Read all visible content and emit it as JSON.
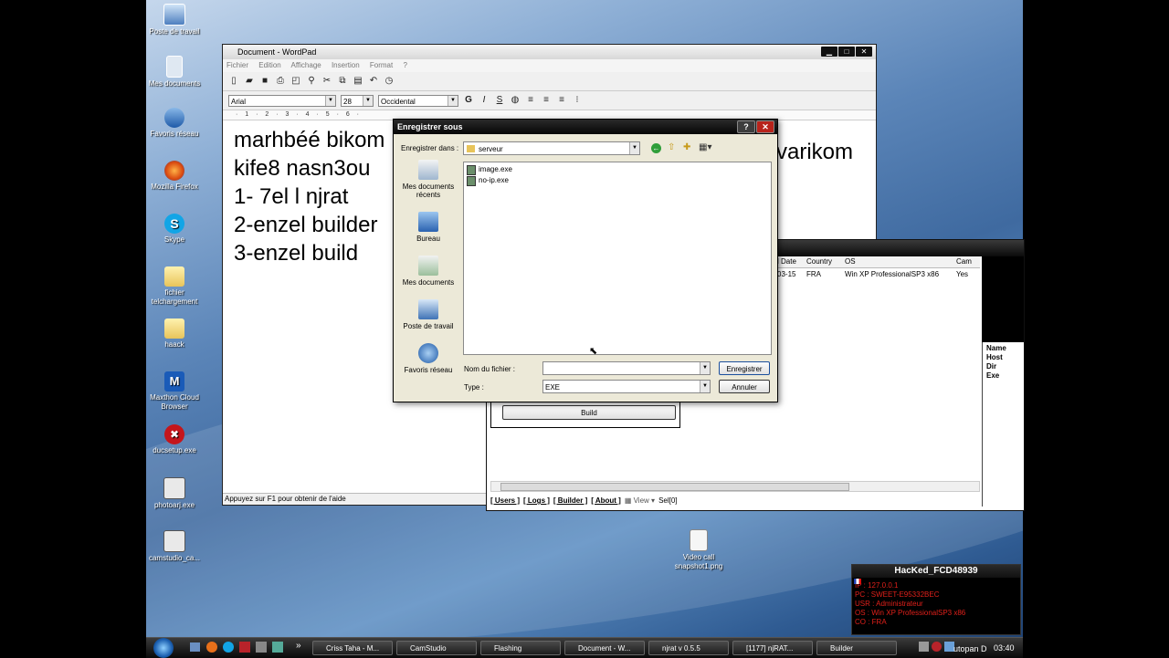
{
  "desktop_icons": [
    {
      "label": "Poste de travail"
    },
    {
      "label": "Mes documents"
    },
    {
      "label": "Favoris réseau"
    },
    {
      "label": "Mozilla Firefox"
    },
    {
      "label": "Skype"
    },
    {
      "label": "fichier telchargement"
    },
    {
      "label": "haack"
    },
    {
      "label": "Maxthon Cloud Browser"
    },
    {
      "label": "ducsetup.exe"
    },
    {
      "label": "photoarj.exe"
    },
    {
      "label": "camstudio_ca..."
    }
  ],
  "wordpad": {
    "title": "Document - WordPad",
    "menu": [
      "Fichier",
      "Edition",
      "Affichage",
      "Insertion",
      "Format",
      "?"
    ],
    "font": "Arial",
    "size": "28",
    "script": "Occidental",
    "ruler": "· 1 · 2 · 3 · 4 · 5 · 6 ·",
    "lines": [
      "marhbéé bikom",
      "kife8 nasn3ou",
      "1- 7el l njrat",
      "2-enzel builder",
      "3-enzel build"
    ],
    "right_text": "varikom",
    "status": "Appuyez sur F1 pour obtenir de l'aide"
  },
  "dialog": {
    "title": "Enregistrer sous",
    "save_in_label": "Enregistrer dans :",
    "save_in_value": "serveur",
    "places": [
      "Mes documents récents",
      "Bureau",
      "Mes documents",
      "Poste de travail",
      "Favoris réseau"
    ],
    "files": [
      "image.exe",
      "no-ip.exe"
    ],
    "filename_label": "Nom du fichier :",
    "filename_value": "",
    "type_label": "Type :",
    "type_value": "EXE",
    "save_button": "Enregistrer",
    "cancel_button": "Annuler",
    "help_glyph": "?",
    "close_glyph": "✕"
  },
  "njrat": {
    "columns": [
      "l Date",
      "Country",
      "OS",
      "Cam"
    ],
    "row": [
      "03-15",
      "FRA",
      "Win XP ProfessionalSP3 x86",
      "Yes"
    ],
    "side_fields": [
      "Name",
      "Host",
      "Dir",
      "Exe"
    ],
    "build_button": "Build",
    "tabs": [
      "[ Users ]",
      "[ Logs ]",
      "[ Builder ]",
      "[ About ]"
    ],
    "view_label": "View",
    "sel_label": "Sel[0]"
  },
  "desktop_file": {
    "label": "Video call snapshot1.png"
  },
  "notification": {
    "title": "HacKed_FCD48939",
    "lines": [
      "IP : 127.0.0.1",
      "PC : SWEET-E95332BEC",
      "USR : Administrateur",
      "OS : Win XP ProfessionalSP3 x86",
      "CO : FRA"
    ]
  },
  "taskbar": {
    "tasks": [
      "Criss Taha - M...",
      "CamStudio",
      "Flashing",
      "Document - W...",
      "njrat v 0.5.5",
      "[1177] njRAT...",
      "Builder"
    ],
    "tray_text": "utopan D",
    "clock": "03:40"
  }
}
